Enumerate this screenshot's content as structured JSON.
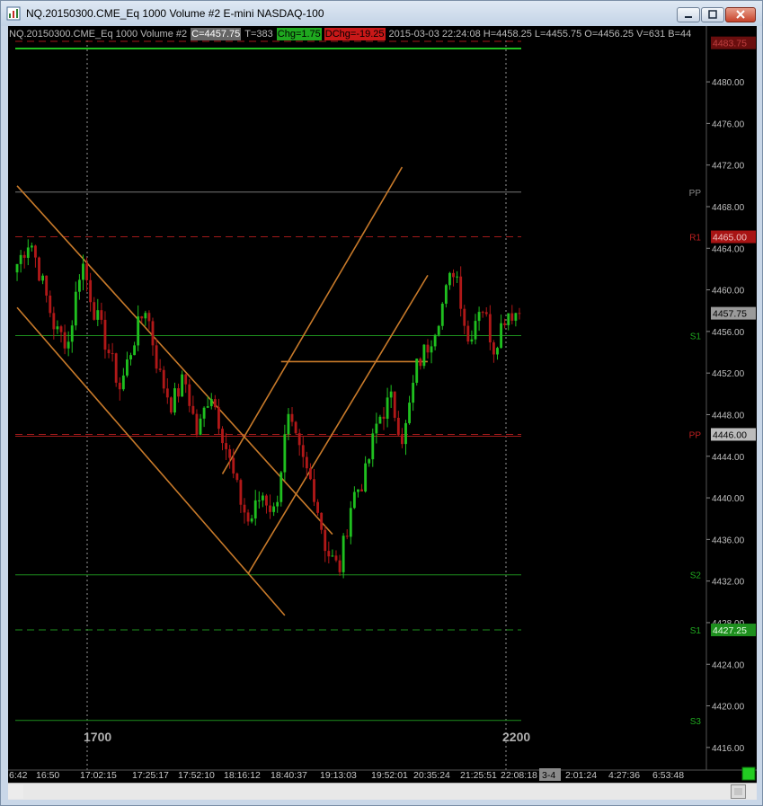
{
  "window": {
    "title": "NQ.20150300.CME_Eq  1000 Volume  #2  E-mini NASDAQ-100"
  },
  "infobar": {
    "symbol": "NQ.20150300.CME_Eq  1000 Volume  #2",
    "close": "C=4457.75",
    "trades": "T=383",
    "change": "Chg=1.75",
    "daily_change": "DChg=-19.25",
    "details": "2015-03-03 22:24:08  H=4458.25  L=4455.75  O=4456.25  V=631  B=44"
  },
  "colors": {
    "background": "#000000",
    "up_bar": "#1fbf1f",
    "down_bar": "#b01818",
    "trendline": "#c87a2a",
    "level_green": "#1e8f1e",
    "level_red": "#a01a1a",
    "axis_text": "#c0c0c0"
  },
  "price_axis": {
    "ticks": [
      "4480.00",
      "4476.00",
      "4472.00",
      "4468.00",
      "4464.00",
      "4460.00",
      "4456.00",
      "4452.00",
      "4448.00",
      "4444.00",
      "4440.00",
      "4436.00",
      "4432.00",
      "4428.00",
      "4424.00",
      "4420.00",
      "4416.00"
    ],
    "tick_values": [
      4480,
      4476,
      4472,
      4468,
      4464,
      4460,
      4456,
      4452,
      4448,
      4444,
      4440,
      4436,
      4432,
      4428,
      4424,
      4420,
      4416
    ],
    "range": [
      4414,
      4484.5
    ],
    "current_price": "4457.75",
    "top_badge": "4483.75",
    "top_badge_value": 4483.75
  },
  "levels": [
    {
      "label": "PP",
      "value": 4469.4,
      "color": "#777777",
      "dashed": false,
      "badge": ""
    },
    {
      "label": "R1",
      "value": 4465.1,
      "color": "#a01a1a",
      "dashed": true,
      "badge": "4465.00"
    },
    {
      "label": "S1",
      "value": 4455.6,
      "color": "#1e8f1e",
      "dashed": false,
      "badge": ""
    },
    {
      "label": "PP",
      "value": 4446.1,
      "color": "#a01a1a",
      "dashed": true,
      "badge": "4446.00"
    },
    {
      "label": "S2",
      "value": 4432.6,
      "color": "#1e8f1e",
      "dashed": false,
      "badge": ""
    },
    {
      "label": "S1",
      "value": 4427.3,
      "color": "#1e8f1e",
      "dashed": true,
      "badge": "4427.25"
    },
    {
      "label": "S3",
      "value": 4418.6,
      "color": "#1e8f1e",
      "dashed": false,
      "badge": ""
    }
  ],
  "top_lines": [
    {
      "value": 4483.9,
      "color": "#a01a1a",
      "dashed": true
    },
    {
      "value": 4483.2,
      "color": "#1fbf1f",
      "dashed": false
    }
  ],
  "time_axis": {
    "labels": [
      "6:42",
      "16:50",
      "17:02:15",
      "17:25:17",
      "17:52:10",
      "18:16:12",
      "18:40:37",
      "19:13:03",
      "19:52:01",
      "20:35:24",
      "21:25:51",
      "22:08:18",
      "3-4",
      "2:01:24",
      "4:27:36",
      "6:53:48"
    ],
    "session_markers": [
      "1700",
      "2200"
    ]
  },
  "chart_data": {
    "type": "candlestick",
    "ylim": [
      4414,
      4484.5
    ],
    "bar_count": 138,
    "key_prices": [
      4462.5,
      4465.0,
      4460.5,
      4456.0,
      4455.0,
      4463.0,
      4458.0,
      4454.5,
      4450.5,
      4455.0,
      4458.5,
      4452.0,
      4449.0,
      4451.5,
      4446.0,
      4450.5,
      4446.0,
      4441.0,
      4437.5,
      4440.5,
      4438.5,
      4447.5,
      4444.0,
      4441.0,
      4435.0,
      4433.0,
      4440.0,
      4442.0,
      4447.5,
      4449.5,
      4445.5,
      4452.5,
      4455.0,
      4458.5,
      4462.5,
      4455.0,
      4459.0,
      4454.5,
      4458.0,
      4457.75
    ],
    "trendlines": [
      {
        "from": [
          0,
          4470.0
        ],
        "to": [
          86,
          4436.5
        ]
      },
      {
        "from": [
          0,
          4458.3
        ],
        "to": [
          73,
          4428.7
        ]
      },
      {
        "from": [
          56,
          4442.3
        ],
        "to": [
          105,
          4471.8
        ]
      },
      {
        "from": [
          63,
          4432.7
        ],
        "to": [
          112,
          4461.4
        ]
      },
      {
        "from": [
          72,
          4453.1
        ],
        "to": [
          112,
          4453.1
        ]
      }
    ]
  }
}
